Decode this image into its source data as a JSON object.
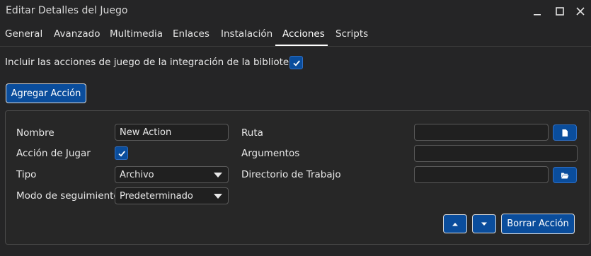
{
  "window": {
    "title": "Editar Detalles del Juego",
    "controls": {
      "minimize": "minimize-icon",
      "maximize": "maximize-icon",
      "close": "close-icon"
    }
  },
  "tabs": [
    {
      "label": "General"
    },
    {
      "label": "Avanzado"
    },
    {
      "label": "Multimedia"
    },
    {
      "label": "Enlaces"
    },
    {
      "label": "Instalación"
    },
    {
      "label": "Acciones",
      "active": true
    },
    {
      "label": "Scripts"
    }
  ],
  "options": {
    "include_library_actions_label": "Incluir las acciones de juego de la integración de la biblioteca.",
    "include_library_actions_checked": true
  },
  "add_action_label": "Agregar Acción",
  "action": {
    "name_label": "Nombre",
    "name_value": "New Action",
    "play_action_label": "Acción de Jugar",
    "play_action_checked": true,
    "type_label": "Tipo",
    "type_value": "Archivo",
    "tracking_label": "Modo de seguimiento",
    "tracking_value": "Predeterminado",
    "path_label": "Ruta",
    "path_value": "",
    "arguments_label": "Argumentos",
    "arguments_value": "",
    "workdir_label": "Directorio de Trabajo",
    "workdir_value": ""
  },
  "remove_action_label": "Borrar Acción",
  "colors": {
    "background": "#252526",
    "accent": "#0a4d9c",
    "text": "#e8e8e8"
  }
}
